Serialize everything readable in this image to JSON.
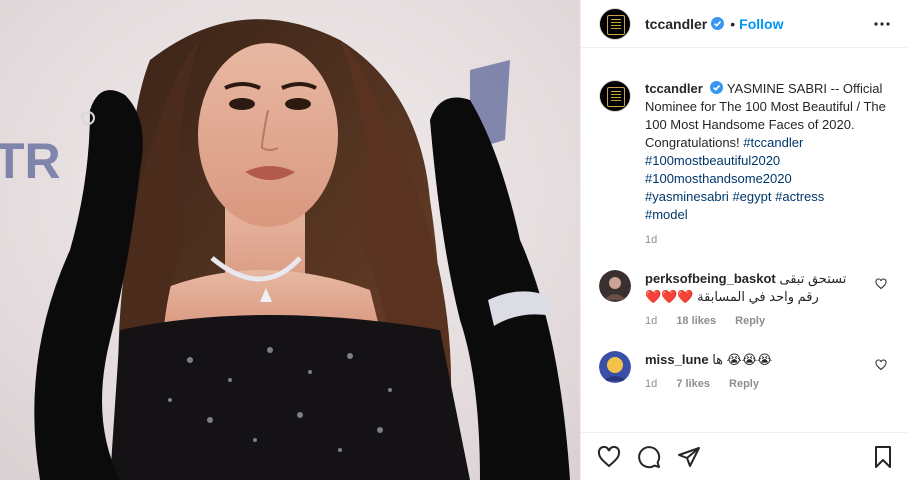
{
  "header": {
    "username": "tccandler",
    "separator": "•",
    "follow_label": "Follow"
  },
  "caption": {
    "username": "tccandler",
    "text_plain": "YASMINE SABRI -- Official Nominee for The 100 Most Beautiful / The 100 Most Handsome Faces of 2020. Congratulations!",
    "tags_line1": "#tccandler",
    "tags_line2": "#100mostbeautiful2020",
    "tags_line3": "#100mosthandsome2020",
    "tags_line4a": "#yasminesabri",
    "tags_line4b": "#egypt",
    "tags_line4c": "#actress",
    "tags_line5": "#model",
    "age": "1d"
  },
  "comments": [
    {
      "username": "perksofbeing_baskot",
      "text_line1": "تستحق تبقى",
      "text_line2": "رقم واحد في المسابقة ❤️❤️❤️",
      "age": "1d",
      "likes": "18 likes",
      "reply_label": "Reply"
    },
    {
      "username": "miss_lune",
      "text": "ها 😭😭😭",
      "age": "1d",
      "likes": "7 likes",
      "reply_label": "Reply"
    }
  ],
  "icons": {
    "verified": "verified-badge-icon",
    "more": "more-options-icon",
    "like": "heart-icon",
    "comment": "comment-icon",
    "share": "paper-plane-icon",
    "save": "bookmark-icon"
  },
  "colors": {
    "accent": "#0095f6",
    "hashtag": "#00376b",
    "muted": "#8e8e8e",
    "verified": "#3897f0"
  }
}
